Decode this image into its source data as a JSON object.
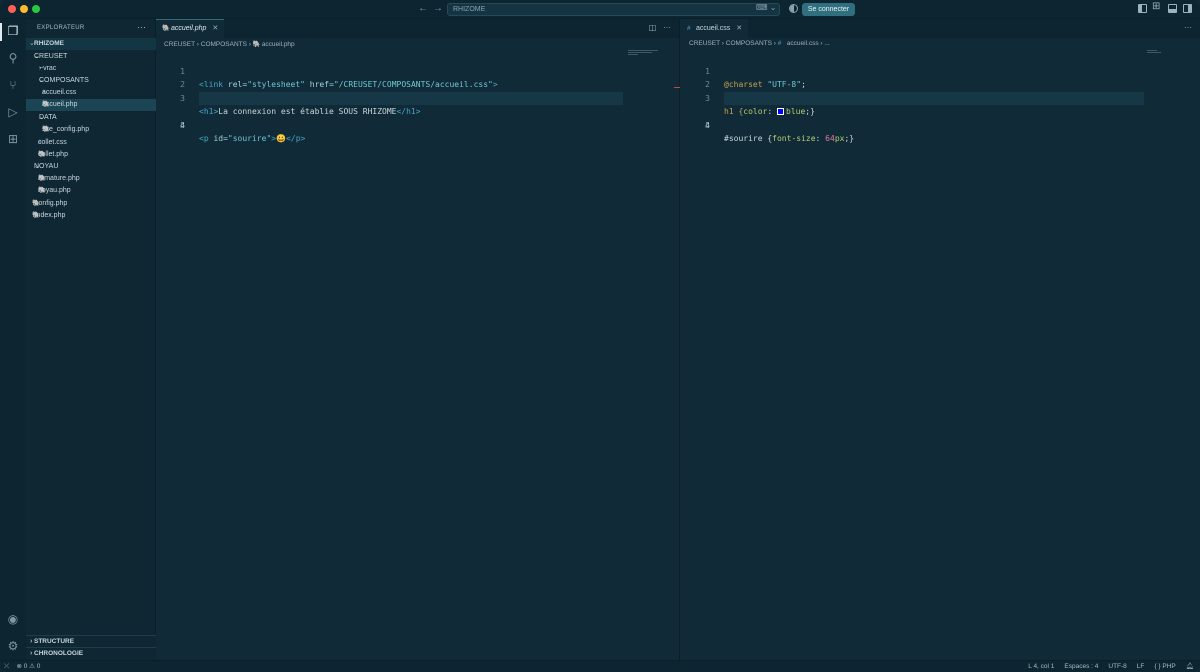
{
  "titlebar": {
    "search_text": "RHIZOME",
    "connect_label": "Se connecter"
  },
  "sidebar": {
    "header": "EXPLORATEUR",
    "more": "···",
    "root": "RHIZOME",
    "tree": [
      {
        "label": "CREUSET",
        "type": "folder",
        "depth": 0,
        "open": true
      },
      {
        "label": "~vrac",
        "type": "folder",
        "depth": 1,
        "open": false
      },
      {
        "label": "COMPOSANTS",
        "type": "folder",
        "depth": 1,
        "open": true
      },
      {
        "label": "accueil.css",
        "type": "css",
        "depth": 2
      },
      {
        "label": "accueil.php",
        "type": "php",
        "depth": 2,
        "selected": true
      },
      {
        "label": "DATA",
        "type": "folder",
        "depth": 1,
        "open": true
      },
      {
        "label": "site_config.php",
        "type": "php",
        "depth": 2
      },
      {
        "label": "collet.css",
        "type": "css",
        "depth": 1
      },
      {
        "label": "collet.php",
        "type": "php",
        "depth": 1
      },
      {
        "label": "NOYAU",
        "type": "folder",
        "depth": 0,
        "open": true
      },
      {
        "label": "armature.php",
        "type": "php",
        "depth": 1
      },
      {
        "label": "noyau.php",
        "type": "php",
        "depth": 1
      },
      {
        "label": "config.php",
        "type": "php",
        "depth": 0
      },
      {
        "label": "index.php",
        "type": "php",
        "depth": 0
      }
    ],
    "sections": [
      "STRUCTURE",
      "CHRONOLOGIE"
    ]
  },
  "left_editor": {
    "tab_label": "accueil.php",
    "breadcrumb": [
      "CREUSET",
      "COMPOSANTS",
      "accueil.php"
    ],
    "line_numbers": [
      "1",
      "2",
      "3",
      "4",
      "5"
    ],
    "lines": {
      "l1_open": "<link",
      "l1_rel": " rel=",
      "l1_relval": "\"stylesheet\"",
      "l1_href": " href=",
      "l1_hrefval": "\"/CREUSET/COMPOSANTS/accueil.css\"",
      "l1_close": ">",
      "l3_open": "<h1>",
      "l3_text": "La connexion est établie SOUS RHIZOME",
      "l3_close": "</h1>",
      "l5_open": "<p",
      "l5_id": " id=",
      "l5_idval": "\"sourire\"",
      "l5_gt": ">",
      "l5_emoji": "😀",
      "l5_close": "</p>"
    }
  },
  "right_editor": {
    "tab_label": "accueil.css",
    "breadcrumb": [
      "CREUSET",
      "COMPOSANTS",
      "accueil.css",
      "..."
    ],
    "line_numbers": [
      "1",
      "2",
      "3",
      "4",
      "5"
    ],
    "lines": {
      "l1_at": "@charset",
      "l1_str": " \"UTF-8\"",
      "l1_end": ";",
      "l3_sel": "h1 {",
      "l3_prop": "color",
      "l3_colon": ": ",
      "l3_val": "blue",
      "l3_end": ";}",
      "l5_sel": "#sourire {",
      "l5_prop": "font-size",
      "l5_colon": ": ",
      "l5_num": "64",
      "l5_unit": "px",
      "l5_end": ";}"
    }
  },
  "statusbar": {
    "errors": "0",
    "warnings": "0",
    "position": "L 4, col 1",
    "spaces": "Espaces : 4",
    "encoding": "UTF-8",
    "eol": "LF",
    "language": "PHP"
  }
}
